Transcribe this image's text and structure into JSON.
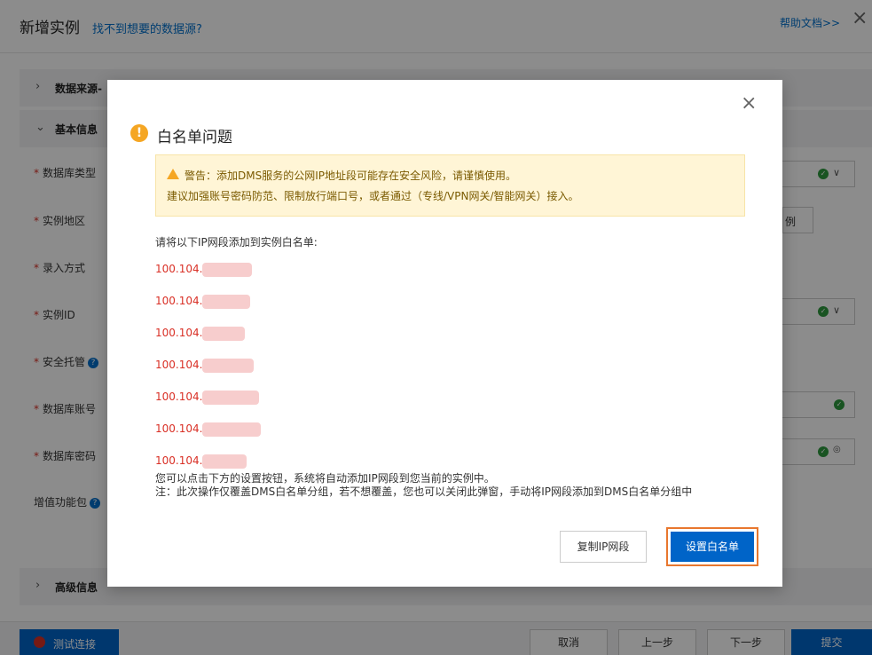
{
  "page": {
    "title": "新增实例",
    "no_source_link": "找不到想要的数据源?",
    "help_link": "帮助文档>>",
    "close_icon": "×"
  },
  "sections": {
    "data_source": "数据来源-",
    "basic_info": "基本信息",
    "advanced_info": "高级信息"
  },
  "form": {
    "fields": [
      {
        "label": "数据库类型",
        "required": true
      },
      {
        "label": "实例地区",
        "required": true
      },
      {
        "label": "录入方式",
        "required": true
      },
      {
        "label": "实例ID",
        "required": true
      },
      {
        "label": "安全托管",
        "required": true,
        "help": true
      },
      {
        "label": "数据库账号",
        "required": true
      },
      {
        "label": "数据库密码",
        "required": true
      },
      {
        "label": "增值功能包",
        "required": false,
        "help": true
      }
    ],
    "region_suffix": "例"
  },
  "footer": {
    "test_connection": "测试连接",
    "cancel": "取消",
    "prev": "上一步",
    "next": "下一步",
    "submit": "提交"
  },
  "dialog": {
    "title": "白名单问题",
    "close_icon": "×",
    "warning_line1": "警告：添加DMS服务的公网IP地址段可能存在安全风险，请谨慎使用。",
    "warning_line2": "建议加强账号密码防范、限制放行端口号，或者通过（专线/VPN网关/智能网关）接入。",
    "ip_intro": "请将以下IP网段添加到实例白名单:",
    "ip_segments": [
      "100.104.",
      "100.104.",
      "100.104.",
      "100.104.",
      "100.104.",
      "100.104.",
      "100.104."
    ],
    "note_line1": "您可以点击下方的设置按钮，系统将自动添加IP网段到您当前的实例中。",
    "note_line2": "注：此次操作仅覆盖DMS白名单分组，若不想覆盖，您也可以关闭此弹窗，手动将IP网段添加到DMS白名单分组中",
    "copy_button": "复制IP网段",
    "set_button": "设置白名单"
  },
  "colors": {
    "primary": "#0064c8",
    "link": "#0070cc",
    "danger": "#d93026",
    "warning": "#f5a623",
    "highlight": "#e8772e"
  },
  "icons": [
    "warning-icon",
    "alert-triangle-icon",
    "close-icon",
    "chevron-right-icon",
    "chevron-down-icon",
    "check-circle-icon",
    "help-icon",
    "error-icon"
  ]
}
